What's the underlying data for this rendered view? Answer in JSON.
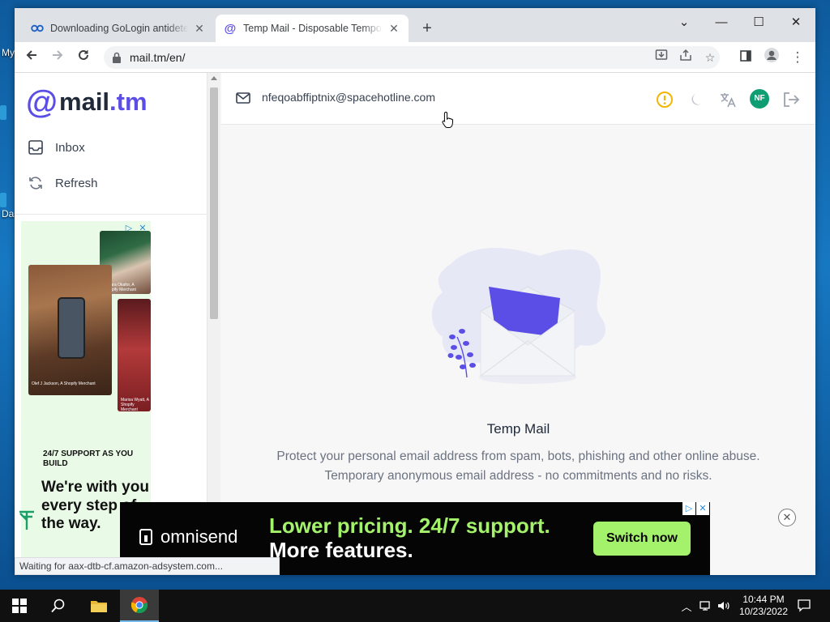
{
  "desktop": {
    "labels": [
      "My",
      "Da"
    ]
  },
  "browser": {
    "tabs": [
      {
        "title": "Downloading GoLogin antidetect browser",
        "favicon": "gologin-icon",
        "active": false
      },
      {
        "title": "Temp Mail - Disposable Temporary Email",
        "favicon": "mailtm-icon",
        "active": true
      }
    ],
    "url": "mail.tm/en/",
    "status_text": "Waiting for aax-dtb-cf.amazon-adsystem.com..."
  },
  "sidebar": {
    "logo": {
      "at": "@",
      "mail": "mail",
      "tm": ".tm"
    },
    "items": [
      {
        "label": "Inbox",
        "icon": "inbox-icon"
      },
      {
        "label": "Refresh",
        "icon": "refresh-icon"
      }
    ]
  },
  "side_ad": {
    "caption_1": "Olef J Jackson, A Shopify Merchant",
    "caption_2": "Amara Okafor, A Shopify Merchant",
    "caption_3": "Marisa Wyatt, A Shopify Merchant",
    "small_text": "24/7 SUPPORT AS YOU BUILD",
    "big_text": "We're with you every step of the way."
  },
  "header": {
    "email": "nfeqoabffiptnix@spacehotline.com",
    "avatar_initials": "NF"
  },
  "empty_state": {
    "title": "Temp Mail",
    "line1": "Protect your personal email address from spam, bots, phishing and other online abuse.",
    "line2": "Temporary anonymous email address - no commitments and no risks."
  },
  "bottom_ad": {
    "brand": "omnisend",
    "headline_1": "Lower pricing. 24/7 support.",
    "headline_2": "More features.",
    "cta": "Switch now"
  },
  "taskbar": {
    "time": "10:44 PM",
    "date": "10/23/2022"
  },
  "colors": {
    "brand": "#5b4ee6",
    "avatar": "#0f9d74",
    "ad_accent": "#a4f26b",
    "warning": "#f4b400"
  }
}
